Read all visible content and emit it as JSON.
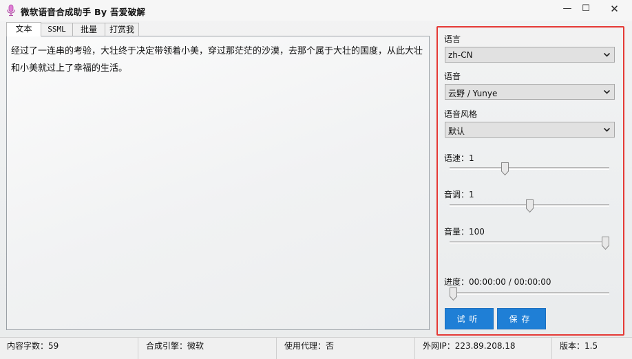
{
  "app": {
    "title": "微软语音合成助手 By 吾爱破解",
    "window_controls": {
      "minimize": "—",
      "maximize": "☐",
      "close": "✕"
    }
  },
  "tabs": [
    {
      "label": "文本",
      "active": true
    },
    {
      "label": "SSML",
      "active": false
    },
    {
      "label": "批量",
      "active": false
    },
    {
      "label": "打赏我",
      "active": false
    }
  ],
  "editor": {
    "text": "经过了一连串的考验，大壮终于决定带领着小美，穿过那茫茫的沙漠，去那个属于大壮的国度，从此大壮和小美就过上了幸福的生活。"
  },
  "settings": {
    "language": {
      "label": "语言",
      "value": "zh-CN"
    },
    "voice": {
      "label": "语音",
      "value": "云野 / Yunye"
    },
    "style": {
      "label": "语音风格",
      "value": "默认"
    },
    "speed": {
      "label": "语速：1",
      "value": 0.34
    },
    "pitch": {
      "label": "音调：1",
      "value": 0.5
    },
    "volume": {
      "label": "音量：100",
      "value": 1.0
    },
    "progress": {
      "label": "进度：00:00:00 / 00:00:00",
      "value": 0.0
    }
  },
  "buttons": {
    "preview": "试听",
    "save": "保存"
  },
  "status": {
    "char_count": "内容字数：59",
    "engine": "合成引擎：微软",
    "proxy": "使用代理：否",
    "ip": "外网IP：223.89.208.18",
    "version": "版本：1.5"
  },
  "colors": {
    "accent": "#1f7fd6",
    "highlight_border": "#e53935"
  }
}
